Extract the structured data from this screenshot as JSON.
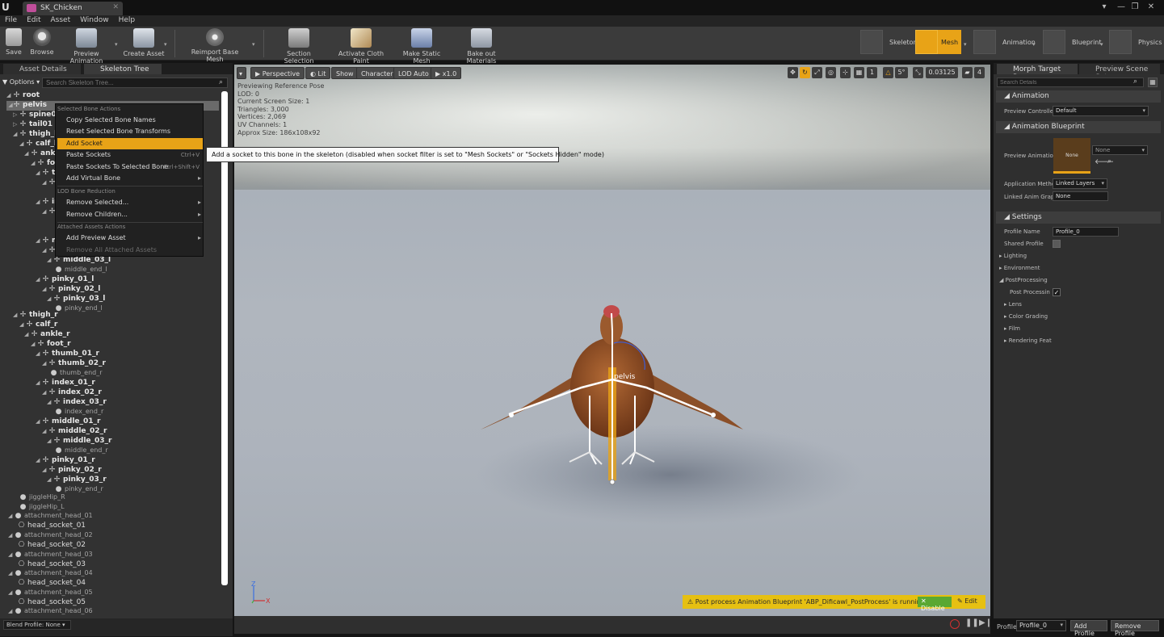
{
  "window": {
    "tab_title": "SK_Chicken",
    "controls": [
      "▾",
      "—",
      "❐",
      "✕"
    ]
  },
  "menu": [
    "File",
    "Edit",
    "Asset",
    "Window",
    "Help"
  ],
  "toolbar": {
    "save": "Save",
    "browse": "Browse",
    "preview_animation": "Preview Animation",
    "create_asset": "Create Asset",
    "reimport": "Reimport Base Mesh",
    "section_selection": "Section Selection",
    "activate_cloth": "Activate Cloth Paint",
    "make_static": "Make Static Mesh",
    "bake_out": "Bake out Materials",
    "modes": [
      "Skeleton",
      "Mesh",
      "Animation",
      "Blueprint",
      "Physics"
    ]
  },
  "left_panel": {
    "tabs": [
      "Asset Details",
      "Skeleton Tree"
    ],
    "options_label": "Options",
    "search_placeholder": "Search Skeleton Tree...",
    "blend_profile": "Blend Profile: None"
  },
  "tree": {
    "root": "root",
    "pelvis": "pelvis",
    "spine01": "spine01",
    "tail01": "tail01",
    "thigh_l": "thigh_l",
    "calf_l": "calf_l",
    "ankle_l": "ankle_l",
    "foot_l": "foot_l",
    "th_l": "th",
    "in_l": "in",
    "m_l": "m",
    "middle_03_l": "middle_03_l",
    "middle_end_l": "middle_end_l",
    "pinky_01_l": "pinky_01_l",
    "pinky_02_l": "pinky_02_l",
    "pinky_03_l": "pinky_03_l",
    "pinky_end_l": "pinky_end_l",
    "thigh_r": "thigh_r",
    "calf_r": "calf_r",
    "ankle_r": "ankle_r",
    "foot_r": "foot_r",
    "thumb_01_r": "thumb_01_r",
    "thumb_02_r": "thumb_02_r",
    "thumb_end_r": "thumb_end_r",
    "index_01_r": "index_01_r",
    "index_02_r": "index_02_r",
    "index_03_r": "index_03_r",
    "index_end_r": "index_end_r",
    "middle_01_r": "middle_01_r",
    "middle_02_r": "middle_02_r",
    "middle_03_r": "middle_03_r",
    "middle_end_r": "middle_end_r",
    "pinky_01_r": "pinky_01_r",
    "pinky_02_r": "pinky_02_r",
    "pinky_03_r": "pinky_03_r",
    "pinky_end_r": "pinky_end_r",
    "jiggleHip_R": "jiggleHip_R",
    "jiggleHip_L": "jiggleHip_L",
    "attachment_head_01": "attachment_head_01",
    "head_socket_01": "head_socket_01",
    "attachment_head_02": "attachment_head_02",
    "head_socket_02": "head_socket_02",
    "attachment_head_03": "attachment_head_03",
    "head_socket_03": "head_socket_03",
    "attachment_head_04": "attachment_head_04",
    "head_socket_04": "head_socket_04",
    "attachment_head_05": "attachment_head_05",
    "head_socket_05": "head_socket_05",
    "attachment_head_06": "attachment_head_06"
  },
  "context_menu": {
    "section_selected": "Selected Bone Actions",
    "copy_names": "Copy Selected Bone Names",
    "reset_transforms": "Reset Selected Bone Transforms",
    "add_socket": "Add Socket",
    "paste_sockets": "Paste Sockets",
    "paste_sockets_sc": "Ctrl+V",
    "paste_to_bone": "Paste Sockets To Selected Bone",
    "paste_to_bone_sc": "Ctrl+Shift+V",
    "add_virtual_bone": "Add Virtual Bone",
    "section_lod": "LOD Bone Reduction",
    "remove_selected": "Remove Selected...",
    "remove_children": "Remove Children...",
    "section_attached": "Attached Assets Actions",
    "add_preview_asset": "Add Preview Asset",
    "remove_all_attached": "Remove All Attached Assets"
  },
  "tooltip": "Add a socket to this bone in the skeleton (disabled when socket filter is set to \"Mesh Sockets\" or \"Sockets Hidden\" mode)",
  "viewport": {
    "perspective": "Perspective",
    "lit": "Lit",
    "show": "Show",
    "character": "Character",
    "lod": "LOD Auto",
    "speed": "x1.0",
    "grid_snap": "1",
    "angle_snap": "5°",
    "scale_snap": "0.03125",
    "camera_speed": "4",
    "stats": [
      "Previewing Reference Pose",
      "LOD: 0",
      "Current Screen Size: 1",
      "Triangles: 3,000",
      "Vertices: 2,069",
      "UV Channels: 1",
      "Approx Size: 186x108x92"
    ],
    "bone_label": "pelvis",
    "axis_z": "Z",
    "axis_x": "X",
    "notification": "Post process Animation Blueprint 'ABP_Dificawl_PostProcess' is running.",
    "disable": "Disable",
    "edit": "Edit"
  },
  "right_panel": {
    "tabs": [
      "Morph Target Prev",
      "Preview Scene Set"
    ],
    "search_placeholder": "Search Details",
    "animation_header": "Animation",
    "preview_controller_label": "Preview Controlle",
    "preview_controller_value": "Default",
    "anim_bp_header": "Animation Blueprint",
    "preview_animation_label": "Preview Animatio",
    "thumbnail_label": "None",
    "anim_asset_value": "None",
    "application_method_label": "Application Metho",
    "application_method_value": "Linked Layers",
    "linked_anim_label": "Linked Anim Grap",
    "linked_anim_value": "None",
    "settings_header": "Settings",
    "profile_name_label": "Profile Name",
    "profile_name_value": "Profile_0",
    "shared_profile_label": "Shared Profile",
    "lighting": "Lighting",
    "environment": "Environment",
    "postprocessing": "PostProcessing",
    "post_processing_enabled": "Post Processin",
    "lens": "Lens",
    "color_grading": "Color Grading",
    "film": "Film",
    "rendering_features": "Rendering Feat",
    "profile_label": "Profile",
    "profile_select": "Profile_0",
    "add_profile": "Add Profile",
    "remove_profile": "Remove Profile"
  },
  "colors": {
    "accent": "#e8a317",
    "notification": "#e6c012",
    "disable_green": "#5aa832",
    "panel_bg": "#323232"
  }
}
